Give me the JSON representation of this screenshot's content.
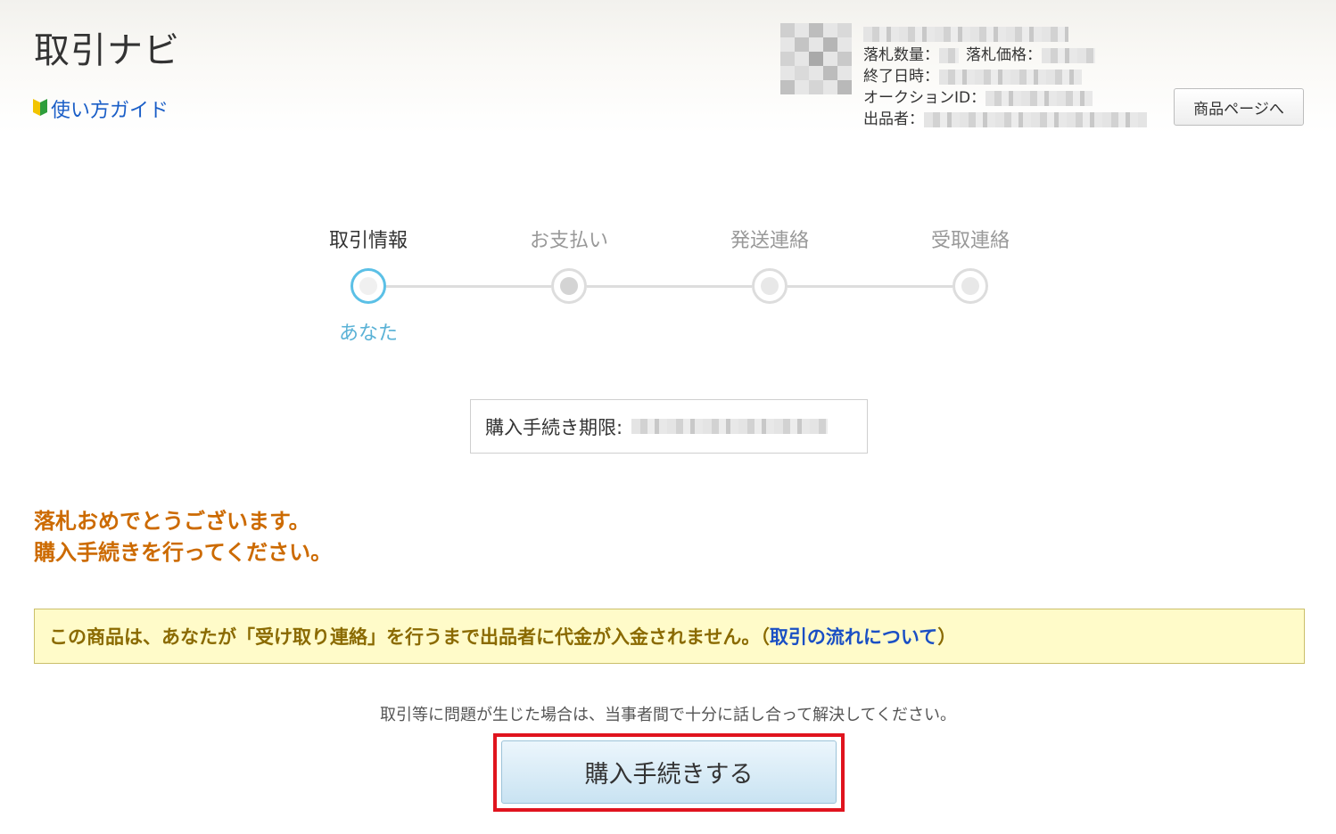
{
  "header": {
    "title": "取引ナビ",
    "guide_label": "使い方ガイド",
    "guide_icon": "beginner-mark-icon",
    "product_button_label": "商品ページへ"
  },
  "item_info": {
    "quantity_label": "落札数量：",
    "price_label": "落札価格：",
    "end_date_label": "終了日時：",
    "auction_id_label": "オークションID：",
    "seller_label": "出品者："
  },
  "steps": {
    "items": [
      {
        "label": "取引情報",
        "state": "active"
      },
      {
        "label": "お支払い",
        "state": "pending"
      },
      {
        "label": "発送連絡",
        "state": "pending"
      },
      {
        "label": "受取連絡",
        "state": "pending"
      }
    ],
    "current_actor": "あなた"
  },
  "deadline": {
    "label": "購入手続き期限:"
  },
  "message": {
    "line1": "落札おめでとうございます。",
    "line2": "購入手続きを行ってください。"
  },
  "notice": {
    "text": "この商品は、あなたが「受け取り連絡」を行うまで出品者に代金が入金されません。（",
    "link": "取引の流れについて",
    "close": "）"
  },
  "advice": "取引等に問題が生じた場合は、当事者間で十分に話し合って解決してください。",
  "purchase_button_label": "購入手続きする",
  "colors": {
    "accent": "#5bc0e6",
    "warning": "#cc6a00",
    "highlight": "#e0141e",
    "link": "#1a5ec7"
  }
}
